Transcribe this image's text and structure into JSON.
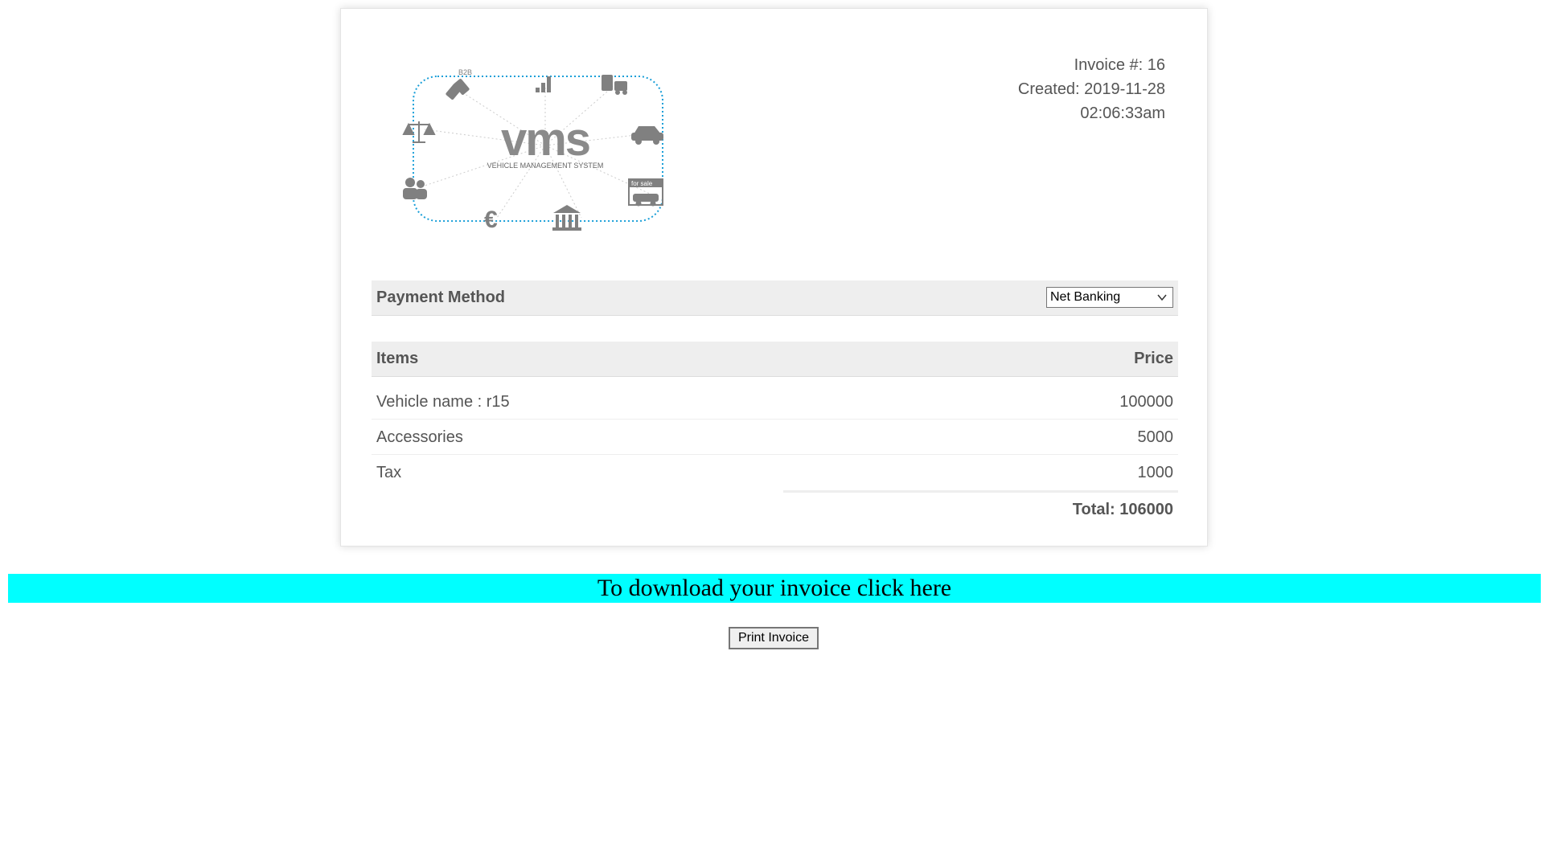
{
  "logo": {
    "main_text": "vms",
    "subtitle": "VEHICLE MANAGEMENT SYSTEM",
    "badge_b2b": "B2B",
    "badge_forsale": "for sale",
    "brand_color": "#1a9fd8",
    "icon_color": "#808080"
  },
  "invoice": {
    "number_label": "Invoice #: 16",
    "created_label": "Created: 2019-11-28",
    "created_time": "02:06:33am"
  },
  "payment": {
    "label": "Payment Method",
    "selected_option": "Net Banking"
  },
  "items_table": {
    "header_items": "Items",
    "header_price": "Price",
    "rows": [
      {
        "name": "Vehicle name : r15",
        "price": "100000"
      },
      {
        "name": "Accessories",
        "price": "5000"
      },
      {
        "name": "Tax",
        "price": "1000"
      }
    ],
    "total": "Total: 106000"
  },
  "download": {
    "text": "To download your invoice click here",
    "color": "#00ffff"
  },
  "print_button": {
    "label": "Print Invoice"
  }
}
